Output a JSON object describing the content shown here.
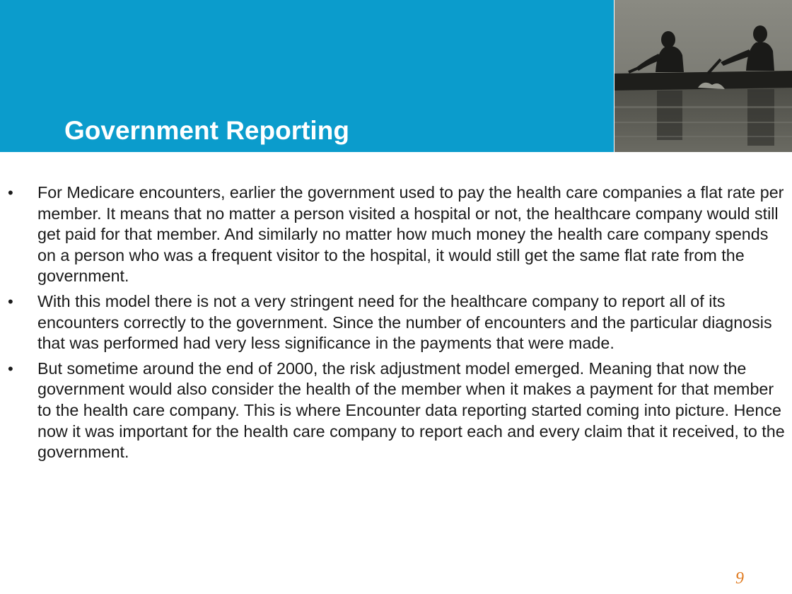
{
  "slide": {
    "title": "Government Reporting",
    "bullets": [
      "For Medicare encounters, earlier the government used to pay the health care companies a flat rate per member. It means that no matter a person visited a hospital or not, the healthcare company would still get paid for that member. And similarly no matter how much money the health care company spends on a person who was a frequent visitor to the hospital, it would still get the same flat rate from the government.",
      "With this model there is not a very stringent need for the healthcare company to report all of its encounters correctly to the government. Since the number of encounters and the particular diagnosis that was performed had very less significance in the payments that were made.",
      "But sometime around the end of 2000, the risk adjustment model emerged. Meaning that now the government would also consider the health of the member when it makes a payment for that member to the health care company. This is where Encounter data reporting started coming into picture. Hence now it was important for the health care company to report each and every claim that it received, to the government."
    ],
    "bullet_symbol": "•",
    "page_number": "9",
    "colors": {
      "header_band": "#0b9ccc",
      "title_text": "#ffffff",
      "page_number": "#e07a1f"
    }
  }
}
